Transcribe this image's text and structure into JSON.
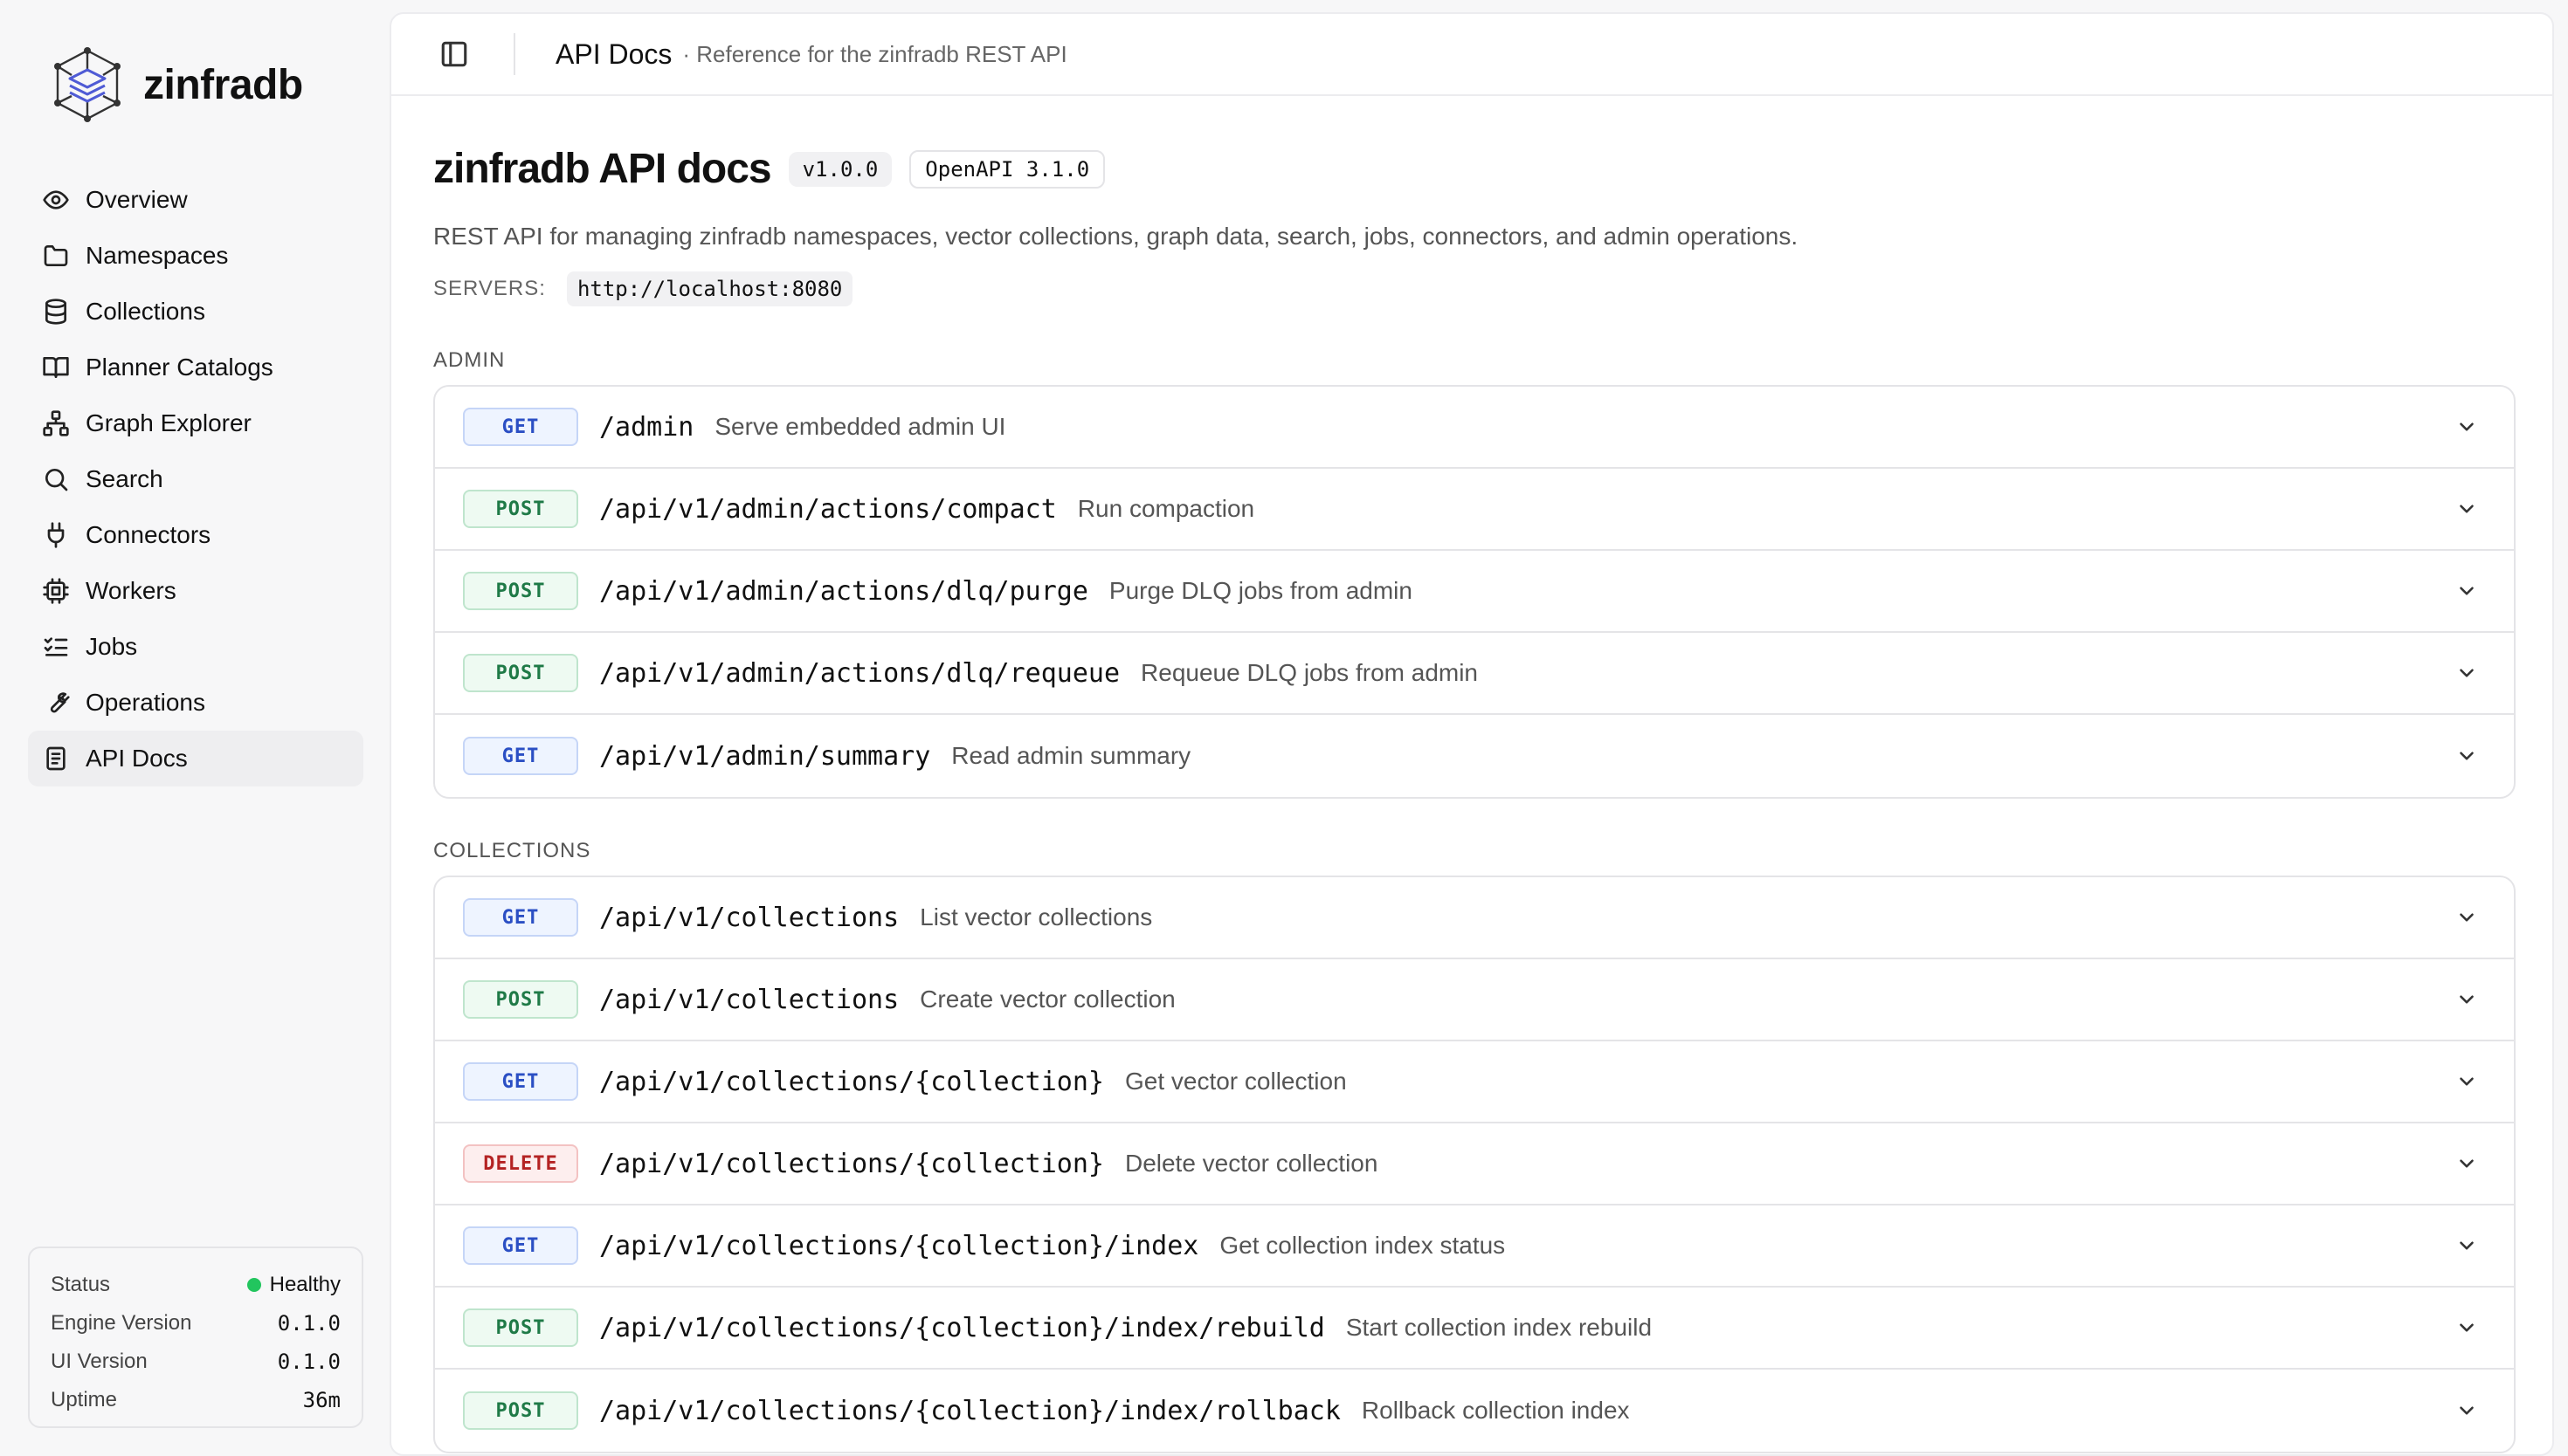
{
  "brand": {
    "name": "zinfradb"
  },
  "sidebar": {
    "items": [
      {
        "label": "Overview",
        "icon": "eye-icon"
      },
      {
        "label": "Namespaces",
        "icon": "folder-icon"
      },
      {
        "label": "Collections",
        "icon": "database-icon"
      },
      {
        "label": "Planner Catalogs",
        "icon": "book-open-icon"
      },
      {
        "label": "Graph Explorer",
        "icon": "graph-icon"
      },
      {
        "label": "Search",
        "icon": "search-icon"
      },
      {
        "label": "Connectors",
        "icon": "plug-icon"
      },
      {
        "label": "Workers",
        "icon": "cpu-icon"
      },
      {
        "label": "Jobs",
        "icon": "list-checks-icon"
      },
      {
        "label": "Operations",
        "icon": "wrench-icon"
      },
      {
        "label": "API Docs",
        "icon": "document-icon",
        "active": true
      }
    ]
  },
  "status": {
    "status_label": "Status",
    "status_value": "Healthy",
    "engine_label": "Engine Version",
    "engine_value": "0.1.0",
    "ui_label": "UI Version",
    "ui_value": "0.1.0",
    "uptime_label": "Uptime",
    "uptime_value": "36m",
    "health_color": "#22c55e"
  },
  "topbar": {
    "title": "API Docs",
    "subtitle": "· Reference for the zinfradb REST API"
  },
  "page": {
    "title": "zinfradb API docs",
    "version": "v1.0.0",
    "openapi": "OpenAPI 3.1.0",
    "description": "REST API for managing zinfradb namespaces, vector collections, graph data, search, jobs, connectors, and admin operations.",
    "servers_label": "SERVERS:",
    "server_url": "http://localhost:8080"
  },
  "sections": [
    {
      "label": "ADMIN",
      "endpoints": [
        {
          "method": "GET",
          "path": "/admin",
          "summary": "Serve embedded admin UI"
        },
        {
          "method": "POST",
          "path": "/api/v1/admin/actions/compact",
          "summary": "Run compaction"
        },
        {
          "method": "POST",
          "path": "/api/v1/admin/actions/dlq/purge",
          "summary": "Purge DLQ jobs from admin"
        },
        {
          "method": "POST",
          "path": "/api/v1/admin/actions/dlq/requeue",
          "summary": "Requeue DLQ jobs from admin"
        },
        {
          "method": "GET",
          "path": "/api/v1/admin/summary",
          "summary": "Read admin summary"
        }
      ]
    },
    {
      "label": "COLLECTIONS",
      "endpoints": [
        {
          "method": "GET",
          "path": "/api/v1/collections",
          "summary": "List vector collections"
        },
        {
          "method": "POST",
          "path": "/api/v1/collections",
          "summary": "Create vector collection"
        },
        {
          "method": "GET",
          "path": "/api/v1/collections/{collection}",
          "summary": "Get vector collection"
        },
        {
          "method": "DELETE",
          "path": "/api/v1/collections/{collection}",
          "summary": "Delete vector collection"
        },
        {
          "method": "GET",
          "path": "/api/v1/collections/{collection}/index",
          "summary": "Get collection index status"
        },
        {
          "method": "POST",
          "path": "/api/v1/collections/{collection}/index/rebuild",
          "summary": "Start collection index rebuild"
        },
        {
          "method": "POST",
          "path": "/api/v1/collections/{collection}/index/rollback",
          "summary": "Rollback collection index"
        }
      ]
    }
  ]
}
